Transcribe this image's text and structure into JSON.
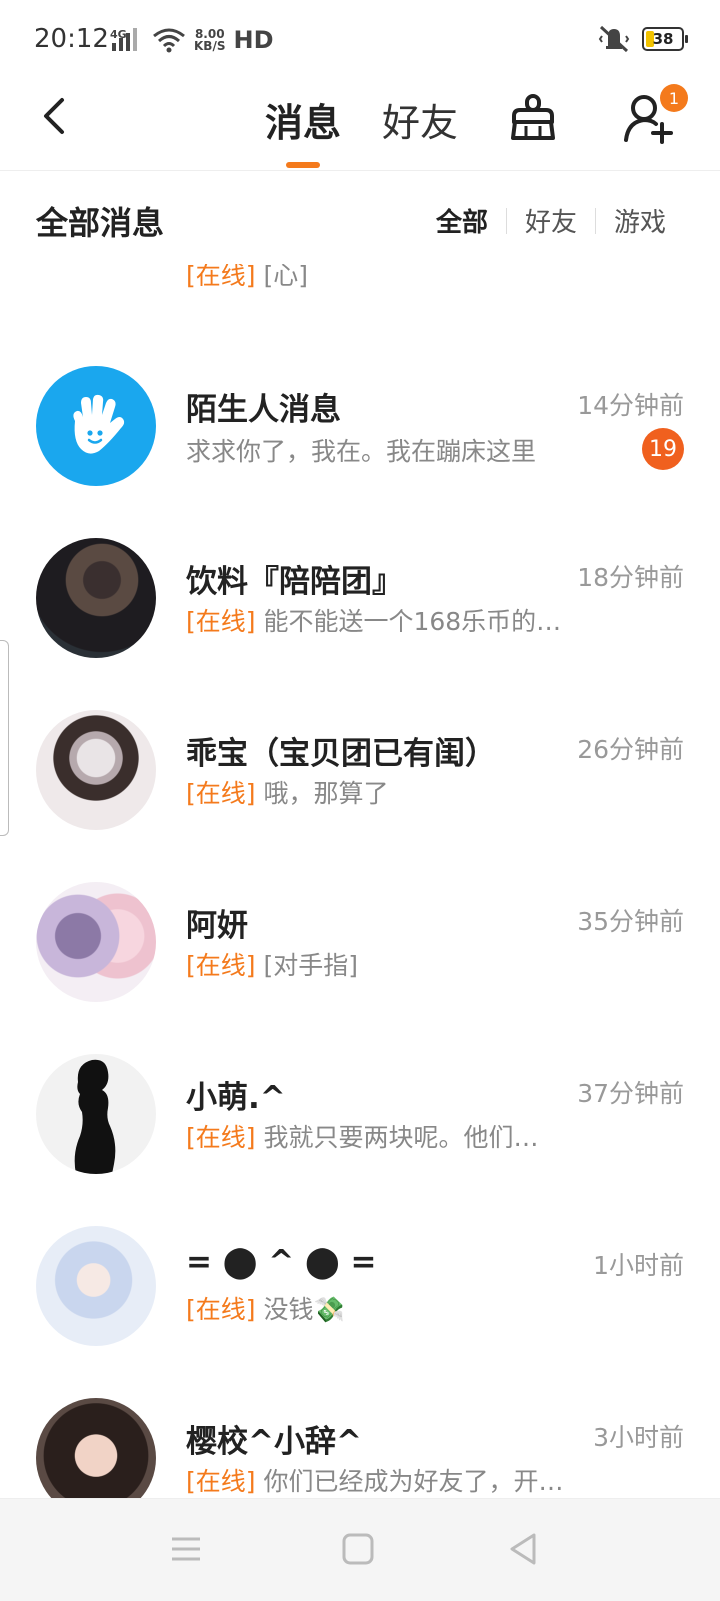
{
  "status_bar": {
    "time": "20:12",
    "network": "4G",
    "speed_value": "8.00",
    "speed_unit": "KB/S",
    "hd": "HD",
    "battery": "38"
  },
  "header": {
    "tabs": [
      "消息",
      "好友"
    ],
    "active_tab": "消息",
    "add_friend_badge": "1",
    "accent_color": "#f47a1c"
  },
  "section": {
    "title": "全部消息",
    "filters": [
      "全部",
      "好友",
      "游戏"
    ],
    "active_filter": "全部"
  },
  "conversations": [
    {
      "name": "",
      "time": "",
      "status": "[在线]",
      "message": "[心]",
      "avatar": "photo-girl-dark-hair"
    },
    {
      "name": "陌生人消息",
      "time": "14分钟前",
      "status": "",
      "message": "求求你了，我在。我在蹦床这里",
      "unread": "19",
      "avatar": "waving-hand-icon"
    },
    {
      "name": "饮料『陪陪团』",
      "time": "18分钟前",
      "status": "[在线]",
      "message": "能不能送一个168乐币的…",
      "avatar": "photo-girl-phone"
    },
    {
      "name": "乖宝（宝贝团已有闺）",
      "time": "26分钟前",
      "status": "[在线]",
      "message": "哦，那算了",
      "avatar": "photo-girl-cat-ears"
    },
    {
      "name": "阿妍",
      "time": "35分钟前",
      "status": "[在线]",
      "message": "[对手指]",
      "avatar": "anime-two-girls"
    },
    {
      "name": "小萌.^",
      "time": "37分钟前",
      "status": "[在线]",
      "message": "我就只要两块呢。他们…",
      "avatar": "silhouette-woman"
    },
    {
      "name": "=  ⬤  ^  ⬤  =",
      "time": "1小时前",
      "status": "[在线]",
      "message": "没钱💸",
      "avatar": "doll-blue-hair"
    },
    {
      "name": "樱校^小辞^",
      "time": "3小时前",
      "status": "[在线]",
      "message": "你们已经成为好友了，开…",
      "avatar": "photo-girl-portrait"
    }
  ]
}
